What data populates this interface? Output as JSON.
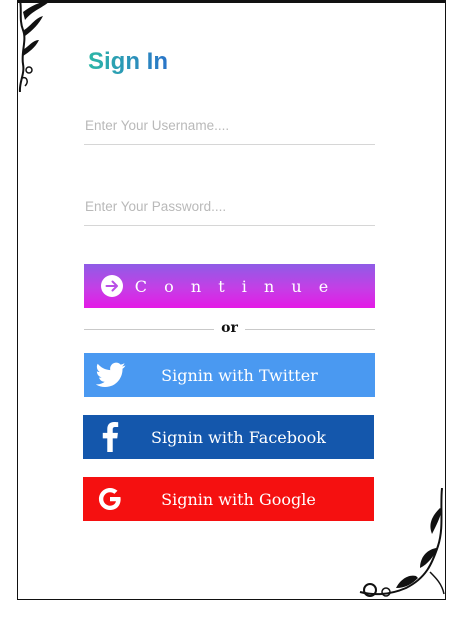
{
  "form": {
    "title": "Sign In",
    "username_placeholder": "Enter Your Username....",
    "password_placeholder": "Enter Your Password....",
    "continue_label": "C o n t i n u e",
    "or_label": "or"
  },
  "social": {
    "twitter_label": "Signin with Twitter",
    "facebook_label": "Signin with Facebook",
    "google_label": "Signin with Google"
  },
  "colors": {
    "twitter": "#4a99f1",
    "facebook": "#1457ac",
    "google": "#f51010",
    "continue_gradient_start": "#8f5ce6",
    "continue_gradient_end": "#e41ae6",
    "title_gradient_start": "#2cb7a6",
    "title_gradient_end": "#2a74c9"
  },
  "icons": {
    "continue": "arrow-right-circle-icon",
    "twitter": "twitter-bird-icon",
    "facebook": "facebook-f-icon",
    "google": "google-g-icon",
    "corner_top_left": "floral-ornament-icon",
    "corner_bottom_right": "floral-ornament-icon"
  }
}
